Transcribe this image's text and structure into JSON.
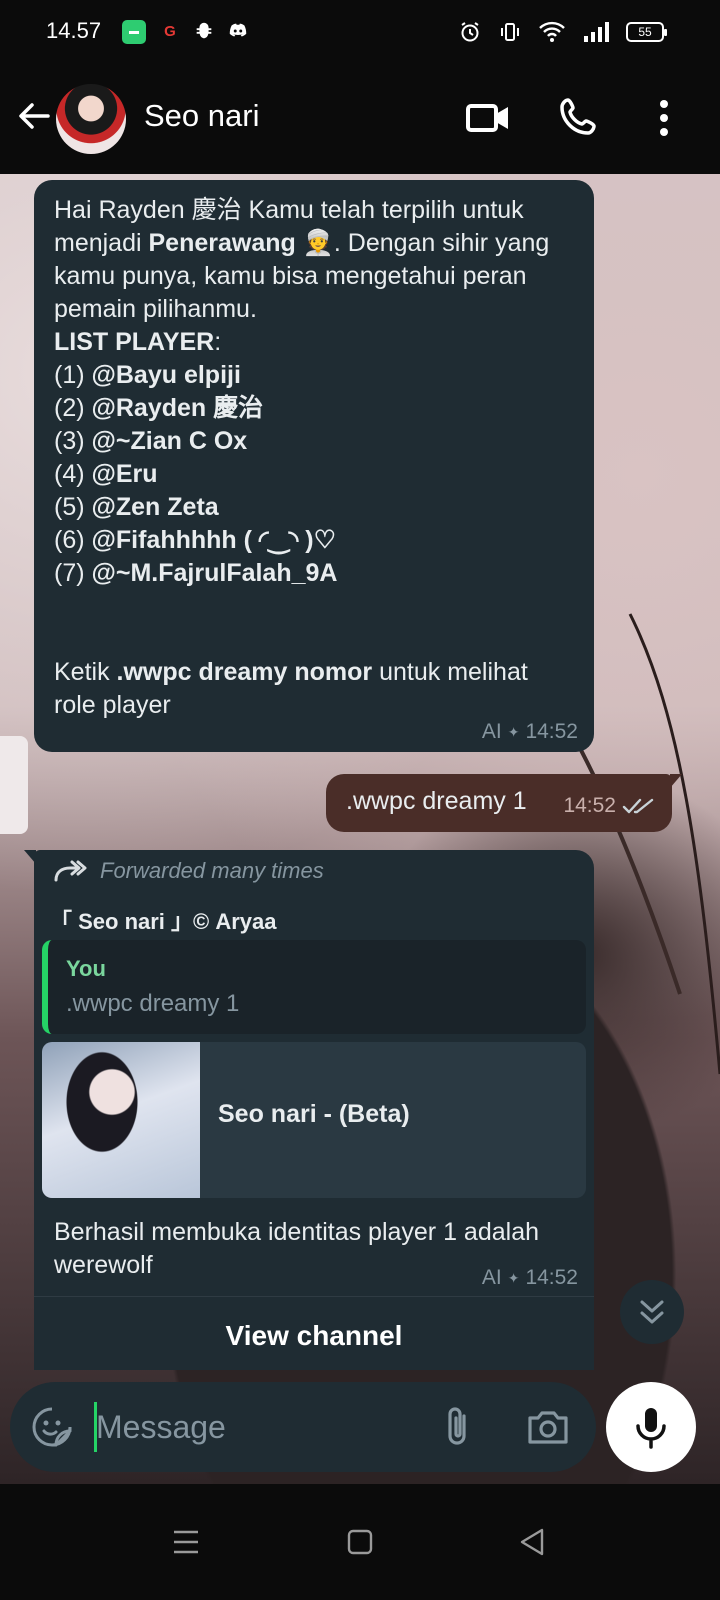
{
  "status_bar": {
    "time": "14.57",
    "app_icons": [
      {
        "name": "line-today-icon",
        "glyph": "▬",
        "color": "#2ecc71"
      },
      {
        "name": "g-app-icon",
        "glyph": "G",
        "color": "#e53935"
      },
      {
        "name": "bug-icon",
        "glyph": "✱",
        "color": "#ffffff"
      },
      {
        "name": "discord-icon",
        "glyph": "◕",
        "color": "#ffffff"
      }
    ],
    "battery": "55"
  },
  "header": {
    "contact_name": "Seo nari"
  },
  "messages": {
    "m1": {
      "intro": "Hai Rayden 慶治 Kamu telah terpilih  untuk menjadi ",
      "role": "Penerawang",
      "role_emoji": "👳",
      "after_role": ". Dengan sihir yang kamu punya, kamu bisa mengetahui peran pemain pilihanmu.",
      "list_title": "LIST PLAYER",
      "list_colon": ":",
      "players": [
        {
          "num": "(1) ",
          "name": "@Bayu elpiji"
        },
        {
          "num": "(2) ",
          "name": "@Rayden 慶治"
        },
        {
          "num": "(3) ",
          "name": "@~Zian C Ox"
        },
        {
          "num": "(4) ",
          "name": "@Eru"
        },
        {
          "num": "(5) ",
          "name": "@Zen Zeta"
        },
        {
          "num": "(6) ",
          "name": "@Fifahhhhh ( ◜‿◝ )♡"
        },
        {
          "num": "(7) ",
          "name": "@~M.FajrulFalah_9A"
        }
      ],
      "cmd_prefix": "Ketik ",
      "cmd": ".wwpc dreamy nomor",
      "cmd_suffix": " untuk melihat role player",
      "label": "AI",
      "time": "14:52"
    },
    "m2": {
      "text": ".wwpc dreamy 1",
      "time": "14:52"
    },
    "m3": {
      "forwarded": "Forwarded many times",
      "sender": "「 Seo nari 」© Aryaa",
      "quote_name": "You",
      "quote_text": ".wwpc dreamy 1",
      "link_title": "Seo nari - (Beta)",
      "text": "Berhasil membuka identitas player 1 adalah werewolf",
      "label": "AI",
      "time": "14:52",
      "view_channel": "View channel"
    }
  },
  "input": {
    "placeholder": "Message"
  },
  "colors": {
    "incoming_bubble": "#1f2c33",
    "outgoing_bubble": "#4a2d28",
    "accent_green": "#25d366",
    "meta_gray": "#8696a0"
  }
}
